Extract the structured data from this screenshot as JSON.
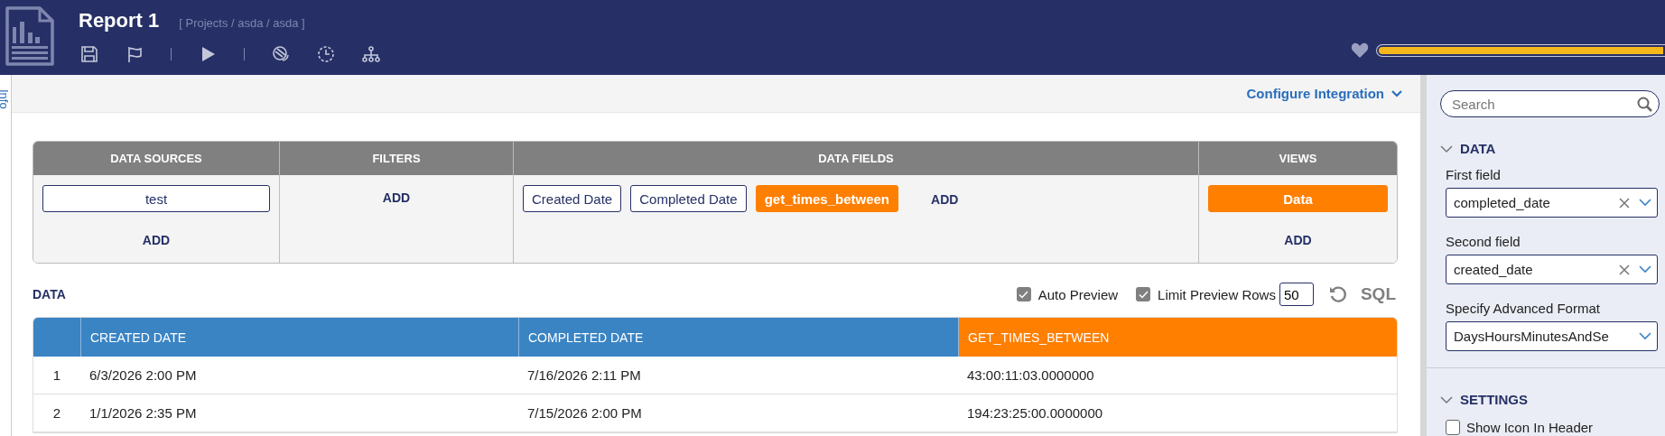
{
  "header": {
    "title": "Report 1",
    "breadcrumb": "[ Projects / asda / asda ]"
  },
  "side_tab": {
    "label": "Info"
  },
  "configure": {
    "label": "Configure Integration"
  },
  "designer": {
    "columns": [
      {
        "title": "DATA SOURCES",
        "kind": "stack",
        "items": [
          {
            "label": "test",
            "kind": "outline"
          }
        ],
        "add": "ADD"
      },
      {
        "title": "FILTERS",
        "kind": "stack",
        "add": "ADD"
      },
      {
        "title": "DATA FIELDS",
        "kind": "row",
        "items": [
          {
            "label": "Created Date",
            "kind": "outline"
          },
          {
            "label": "Completed Date",
            "kind": "outline"
          },
          {
            "label": "get_times_between",
            "kind": "filled"
          }
        ],
        "add": "ADD"
      },
      {
        "title": "VIEWS",
        "kind": "stack",
        "items": [
          {
            "label": "Data",
            "kind": "filled"
          }
        ],
        "add": "ADD"
      }
    ]
  },
  "status_meter": {
    "level": 1
  },
  "preview": {
    "title": "DATA",
    "options": [
      {
        "label": "Auto Preview",
        "checked": true
      },
      {
        "label": "Limit Preview Rows",
        "checked": true
      }
    ],
    "row_limit": "50",
    "sql": "SQL"
  },
  "table": {
    "columns": [
      {
        "label": "CREATED DATE",
        "highlighted": false
      },
      {
        "label": "COMPLETED DATE",
        "highlighted": false
      },
      {
        "label": "GET_TIMES_BETWEEN",
        "highlighted": true
      }
    ],
    "rows": [
      {
        "index": "1",
        "cells": [
          "6/3/2026 2:00 PM",
          "7/16/2026 2:11 PM",
          "43:00:11:03.0000000"
        ]
      },
      {
        "index": "2",
        "cells": [
          "1/1/2026 2:35 PM",
          "7/15/2026 2:00 PM",
          "194:23:25:00.0000000"
        ]
      }
    ]
  },
  "panel": {
    "search_placeholder": "Search",
    "sections": [
      {
        "title": "DATA",
        "expanded": true,
        "fields": [
          {
            "label": "First field",
            "value": "completed_date",
            "clearable": true
          },
          {
            "label": "Second field",
            "value": "created_date",
            "clearable": true
          },
          {
            "label": "Specify Advanced Format",
            "value": "DaysHoursMinutesAndSe",
            "clearable": false
          }
        ]
      },
      {
        "title": "SETTINGS",
        "expanded": true,
        "checkboxes": [
          {
            "label": "Show Icon In Header",
            "checked": false
          }
        ]
      }
    ]
  }
}
